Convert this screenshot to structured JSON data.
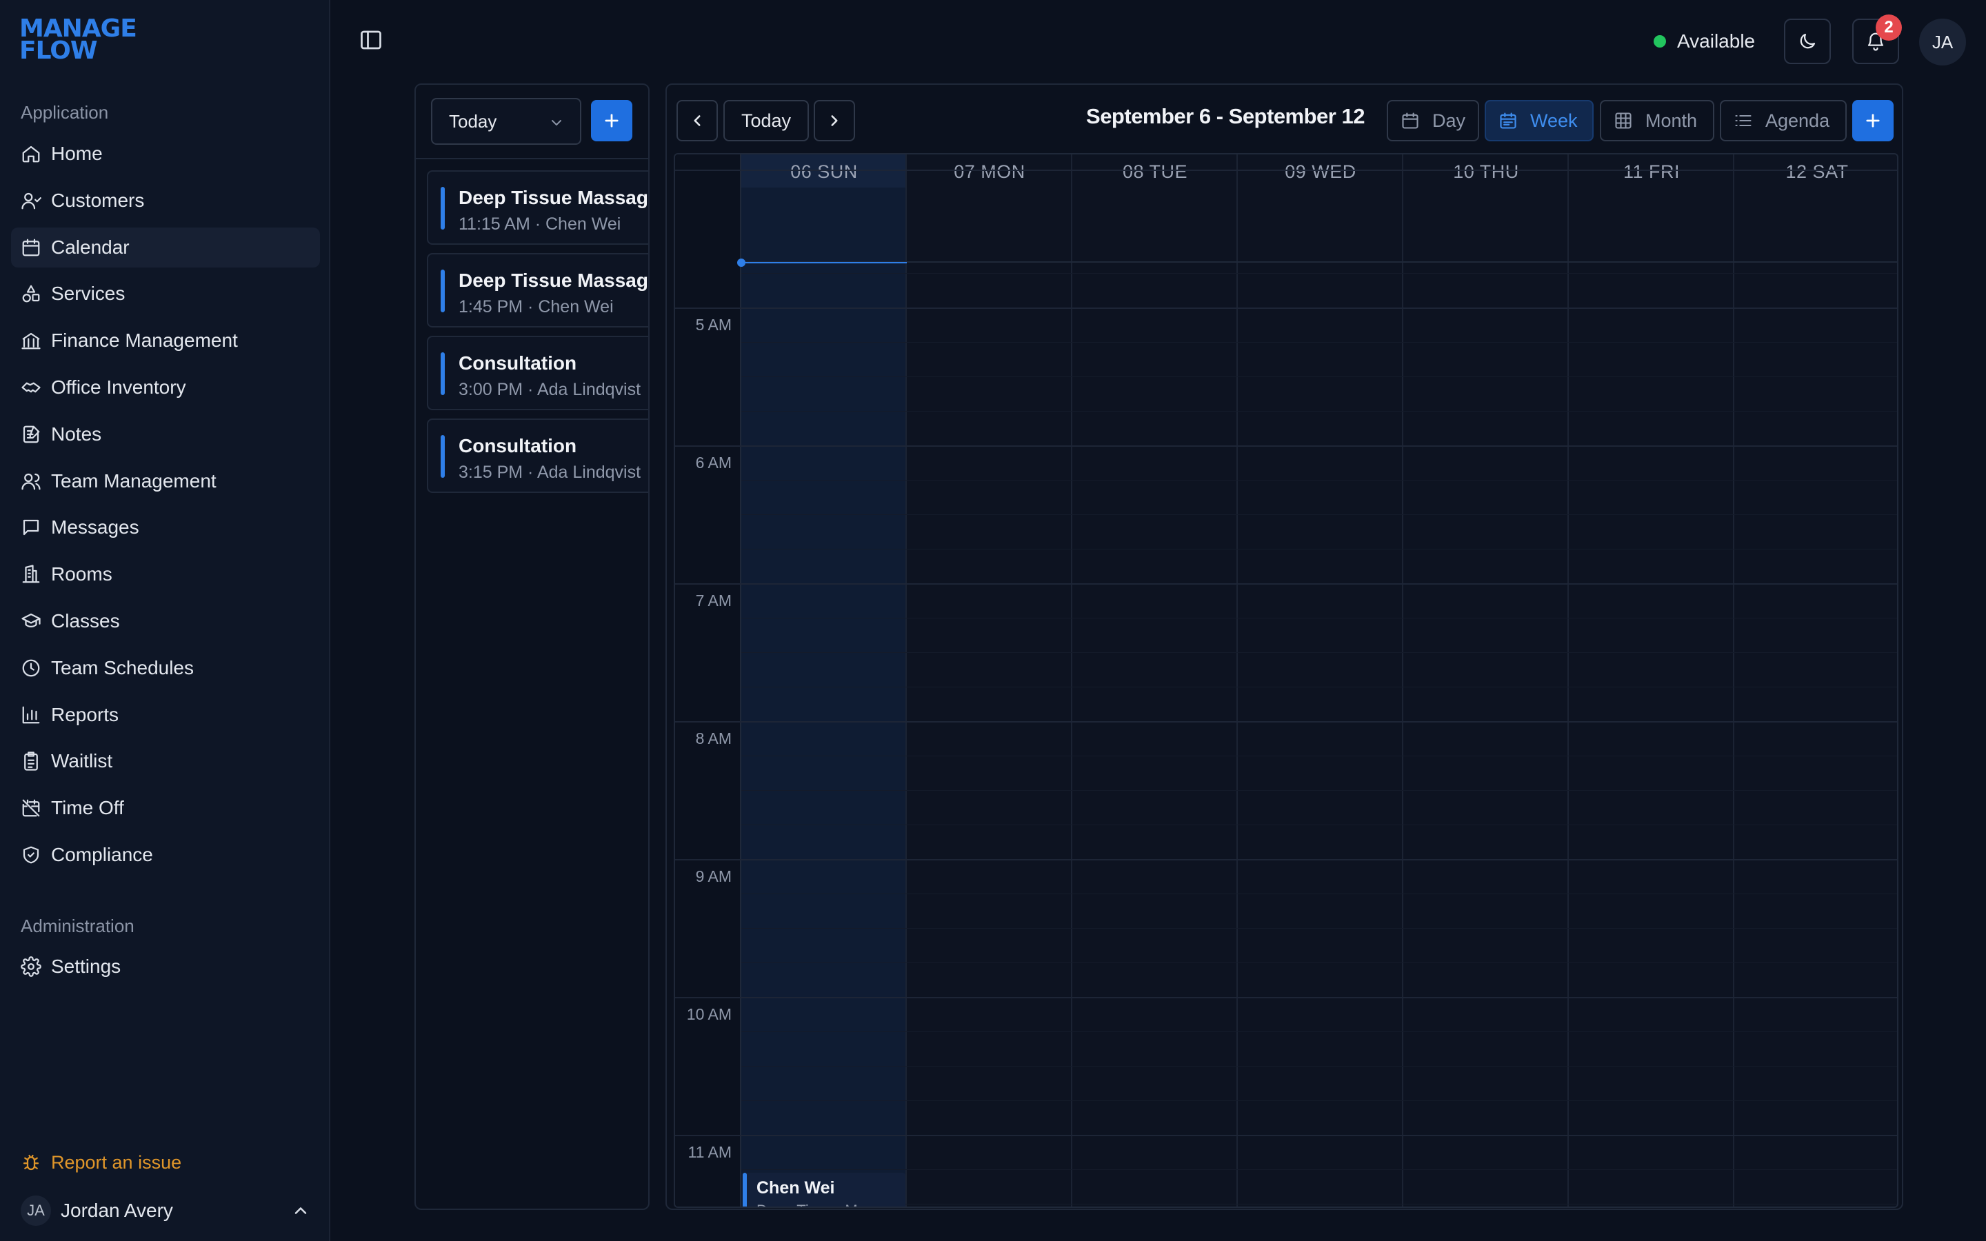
{
  "brand": {
    "line1": "MANAGE",
    "line2": "FLOW"
  },
  "sidebar": {
    "section_application": "Application",
    "items": [
      {
        "label": "Home",
        "icon": "home-icon"
      },
      {
        "label": "Customers",
        "icon": "customers-icon"
      },
      {
        "label": "Calendar",
        "icon": "calendar-icon",
        "active": true
      },
      {
        "label": "Services",
        "icon": "services-icon"
      },
      {
        "label": "Finance Management",
        "icon": "bank-icon"
      },
      {
        "label": "Office Inventory",
        "icon": "handshake-icon"
      },
      {
        "label": "Notes",
        "icon": "notes-icon"
      },
      {
        "label": "Team Management",
        "icon": "team-icon"
      },
      {
        "label": "Messages",
        "icon": "message-icon"
      },
      {
        "label": "Rooms",
        "icon": "building-icon"
      },
      {
        "label": "Classes",
        "icon": "graduation-cap-icon"
      },
      {
        "label": "Team Schedules",
        "icon": "clock-icon"
      },
      {
        "label": "Reports",
        "icon": "bar-chart-icon"
      },
      {
        "label": "Waitlist",
        "icon": "clipboard-icon"
      },
      {
        "label": "Time Off",
        "icon": "calendar-off-icon"
      },
      {
        "label": "Compliance",
        "icon": "shield-check-icon"
      }
    ],
    "section_administration": "Administration",
    "admin_items": [
      {
        "label": "Settings",
        "icon": "gear-icon"
      }
    ],
    "report_issue": "Report an issue",
    "user": {
      "initials": "JA",
      "name": "Jordan Avery"
    }
  },
  "topbar": {
    "status": "Available",
    "status_color": "#22c55e",
    "notifications_count": "2",
    "avatar_initials": "JA"
  },
  "left_panel": {
    "select_value": "Today",
    "events": [
      {
        "title": "Deep Tissue Massage",
        "time": "11:15 AM",
        "person": "Chen Wei"
      },
      {
        "title": "Deep Tissue Massage",
        "time": "1:45 PM",
        "person": "Chen Wei"
      },
      {
        "title": "Consultation",
        "time": "3:00 PM",
        "person": "Ada Lindqvist"
      },
      {
        "title": "Consultation",
        "time": "3:15 PM",
        "person": "Ada Lindqvist"
      }
    ]
  },
  "calendar": {
    "today_label": "Today",
    "range": "September 6 - September 12",
    "views": {
      "day": "Day",
      "week": "Week",
      "month": "Month",
      "agenda": "Agenda"
    },
    "active_view": "Week",
    "days": [
      "06 SUN",
      "07 MON",
      "08 TUE",
      "09 WED",
      "10 THU",
      "11 FRI",
      "12 SAT"
    ],
    "hours": [
      "5 AM",
      "6 AM",
      "7 AM",
      "8 AM",
      "9 AM",
      "10 AM",
      "11 AM"
    ],
    "grid_event": {
      "title": "Chen Wei",
      "subtitle": "Deep Tissue Massage"
    },
    "accent": "#2f7fe8"
  }
}
